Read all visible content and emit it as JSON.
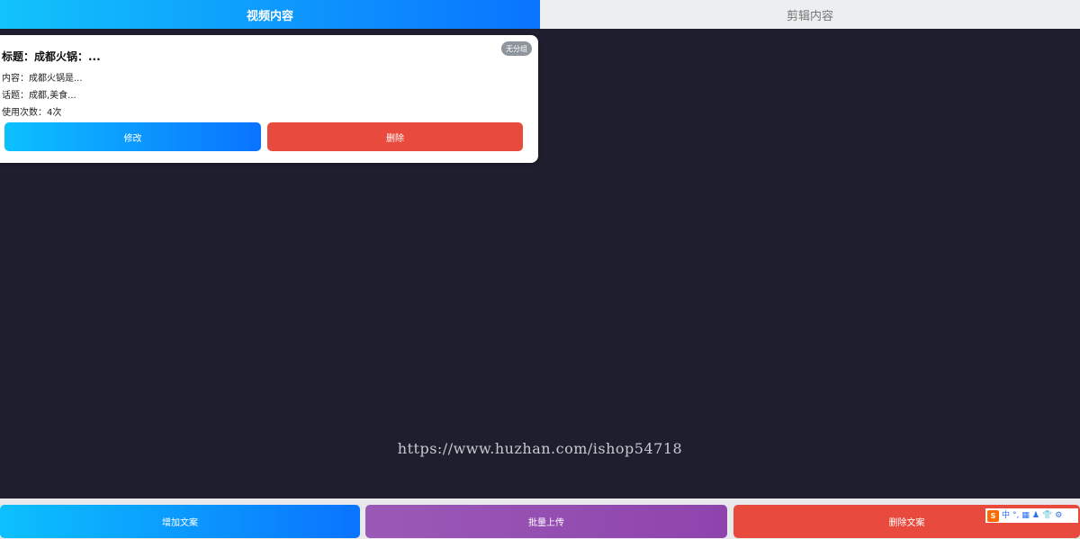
{
  "tabs": [
    {
      "label": "视频内容",
      "active": true
    },
    {
      "label": "剪辑内容",
      "active": false
    }
  ],
  "card": {
    "badge": "无分组",
    "title": "标题：成都火锅：...",
    "content": "内容：成都火锅是...",
    "topic": "话题：成都,美食...",
    "usage": "使用次数：4次",
    "edit_label": "修改",
    "delete_label": "删除"
  },
  "watermark": "https://www.huzhan.com/ishop54718",
  "bottom": {
    "add_label": "增加文案",
    "batch_label": "批量上传",
    "delete_label": "删除文案"
  },
  "ime": {
    "logo": "S",
    "items": [
      "中",
      "°,",
      "▦",
      "♟",
      "👕",
      "⚙"
    ]
  },
  "colors": {
    "accent_start": "#12c3fb",
    "accent_end": "#0a73ff",
    "danger": "#e84b3d",
    "purple": "#9b59b6",
    "background": "#1f1e2e"
  }
}
